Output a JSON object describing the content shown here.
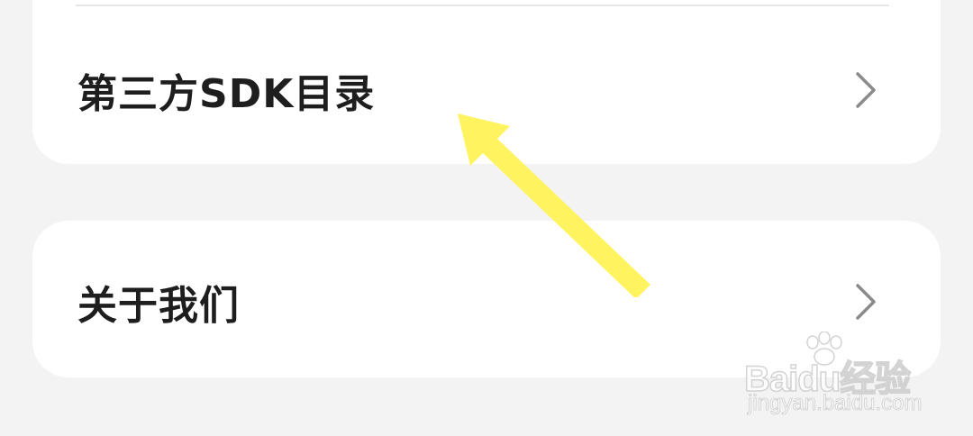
{
  "menu": {
    "items": [
      {
        "label": "第三方SDK目录",
        "icon": "chevron-right-icon"
      },
      {
        "label": "关于我们",
        "icon": "chevron-right-icon"
      }
    ]
  },
  "annotation": {
    "arrow_color": "#fff45f"
  },
  "watermark": {
    "brand": "Baidu经验",
    "url": "jingyan.baidu.com"
  },
  "colors": {
    "background": "#f3f3f3",
    "card": "#ffffff",
    "text": "#1e1e1e",
    "chevron": "#8a8a8a"
  }
}
